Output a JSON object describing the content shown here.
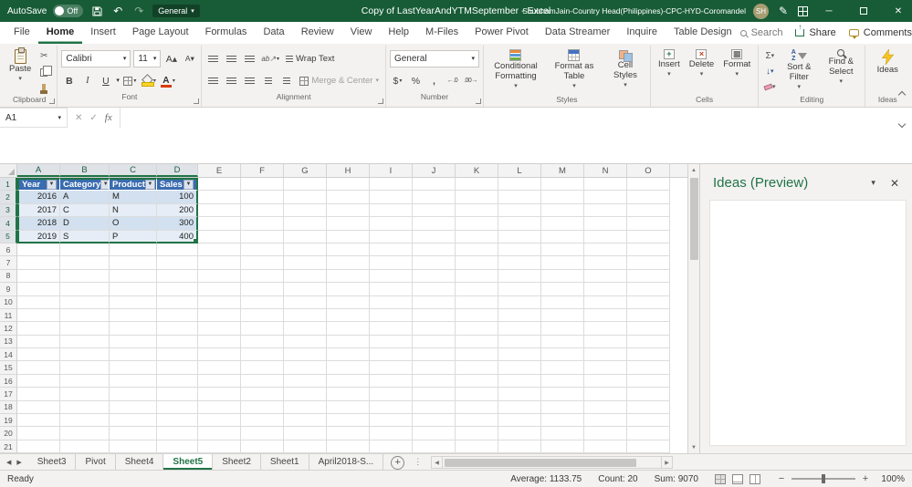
{
  "colors": {
    "titlebar_green": "#185c37",
    "accent_green": "#217346",
    "table_header_blue": "#3a6cb0",
    "band_dark": "#d3e0ef",
    "band_light": "#e6edf6"
  },
  "icons": {
    "chevron_down": "▾",
    "filter": "▼",
    "undo": "↶",
    "redo": "↷",
    "cut": "✂",
    "pen": "✎",
    "minimize": "─",
    "close": "✕",
    "cancel": "✕",
    "check": "✓",
    "sigma": "Σ",
    "fill_down": "↓",
    "nav_left": "◀",
    "nav_right": "▶",
    "scroll_up": "▲",
    "scroll_down": "▼",
    "add": "+",
    "dots": "⋮",
    "percent": "%",
    "comma": ",",
    "accounting": "$",
    "inc_decimal": "←.0",
    "dec_decimal": ".00→",
    "orientation_ab": "ab↗",
    "wrap_arrow": "↩",
    "merge_arrows": "↔",
    "font_bigger": "A▴",
    "font_smaller": "A▾",
    "bold": "B",
    "italic": "I",
    "underline": "U",
    "zoom_out": "−",
    "zoom_in": "+"
  },
  "titlebar": {
    "autosave_label": "AutoSave",
    "autosave_state": "Off",
    "style_dropdown": "General",
    "document_title": "Copy of LastYearAndYTMSeptember  -  Excel",
    "user_name": "ShubhamJain-Country Head(Philippines)-CPC-HYD-Coromandel",
    "avatar_initials": "SH"
  },
  "tab_row": {
    "tabs": [
      {
        "label": "File",
        "active": false
      },
      {
        "label": "Home",
        "active": true
      },
      {
        "label": "Insert",
        "active": false
      },
      {
        "label": "Page Layout",
        "active": false
      },
      {
        "label": "Formulas",
        "active": false
      },
      {
        "label": "Data",
        "active": false
      },
      {
        "label": "Review",
        "active": false
      },
      {
        "label": "View",
        "active": false
      },
      {
        "label": "Help",
        "active": false
      },
      {
        "label": "M-Files",
        "active": false
      },
      {
        "label": "Power Pivot",
        "active": false
      },
      {
        "label": "Data Streamer",
        "active": false
      },
      {
        "label": "Inquire",
        "active": false
      },
      {
        "label": "Table Design",
        "active": false
      }
    ],
    "search_label": "Search",
    "share_label": "Share",
    "comments_label": "Comments"
  },
  "ribbon": {
    "paste_label": "Paste",
    "font_name": "Calibri",
    "font_size": "11",
    "wrap_text_label": "Wrap Text",
    "merge_center_label": "Merge & Center",
    "number_format": "General",
    "conditional_formatting_label": "Conditional Formatting",
    "format_as_table_label": "Format as Table",
    "cell_styles_label": "Cell Styles",
    "insert_label": "Insert",
    "delete_label": "Delete",
    "format_label": "Format",
    "sort_filter_label": "Sort & Filter",
    "find_select_label": "Find & Select",
    "ideas_label": "Ideas",
    "groups": {
      "clipboard": "Clipboard",
      "font": "Font",
      "alignment": "Alignment",
      "number": "Number",
      "styles": "Styles",
      "cells": "Cells",
      "editing": "Editing",
      "ideas": "Ideas"
    }
  },
  "formula_bar": {
    "name_box": "A1",
    "fx_label": "fx",
    "formula_value": ""
  },
  "grid": {
    "column_letters": [
      "A",
      "B",
      "C",
      "D",
      "E",
      "F",
      "G",
      "H",
      "I",
      "J",
      "K",
      "L",
      "M",
      "N",
      "O"
    ],
    "row_count": 21,
    "selected_columns": 4,
    "selected_rows": 5,
    "table": {
      "headers": [
        "Year",
        "Category",
        "Product",
        "Sales"
      ],
      "rows": [
        [
          "2016",
          "A",
          "M",
          "100"
        ],
        [
          "2017",
          "C",
          "N",
          "200"
        ],
        [
          "2018",
          "D",
          "O",
          "300"
        ],
        [
          "2019",
          "S",
          "P",
          "400"
        ]
      ]
    }
  },
  "ideas_panel": {
    "title": "Ideas (Preview)"
  },
  "sheet_bar": {
    "tabs": [
      {
        "label": "Sheet3",
        "active": false
      },
      {
        "label": "Pivot",
        "active": false
      },
      {
        "label": "Sheet4",
        "active": false
      },
      {
        "label": "Sheet5",
        "active": true
      },
      {
        "label": "Sheet2",
        "active": false
      },
      {
        "label": "Sheet1",
        "active": false
      },
      {
        "label": "April2018-S...",
        "active": false
      }
    ]
  },
  "status_bar": {
    "mode": "Ready",
    "average": "Average: 1133.75",
    "count": "Count: 20",
    "sum": "Sum: 9070",
    "zoom_level": "100%"
  }
}
